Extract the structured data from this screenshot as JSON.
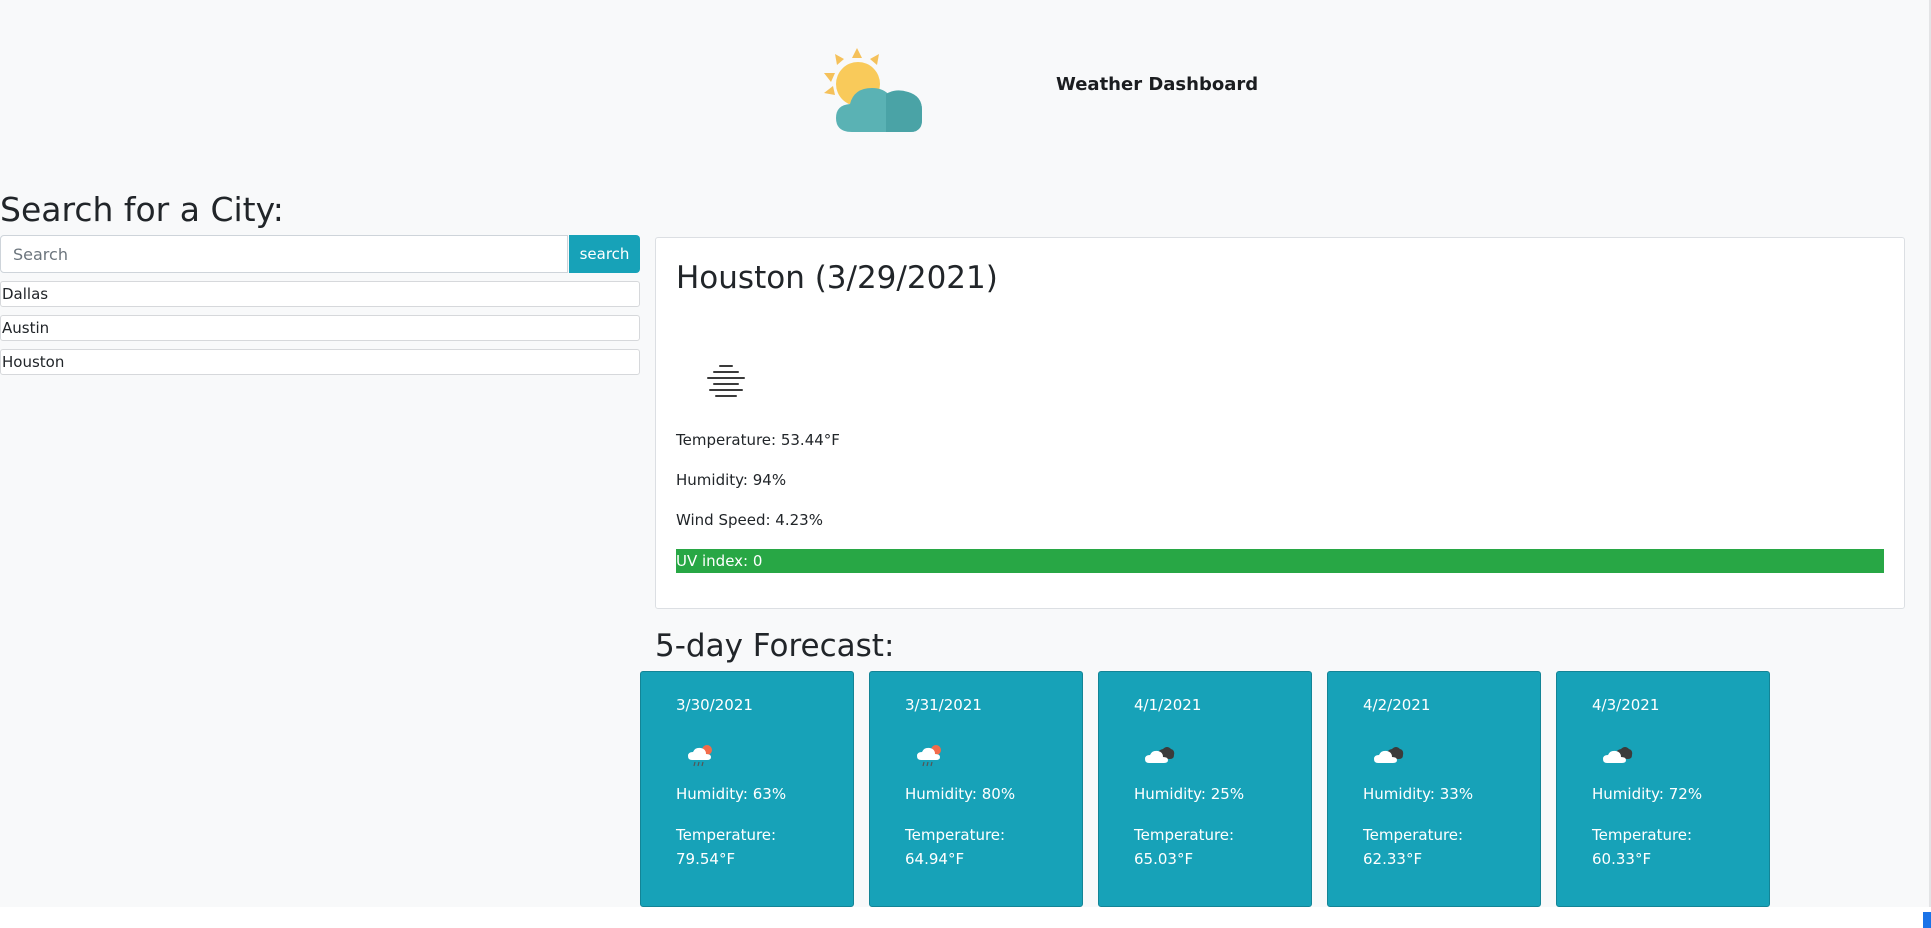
{
  "header": {
    "title": "Weather Dashboard",
    "logo_icon": "sun-behind-cloud-icon"
  },
  "search": {
    "heading": "Search for a City:",
    "placeholder": "Search",
    "value": "",
    "button_label": "search"
  },
  "history": [
    {
      "label": "Dallas"
    },
    {
      "label": "Austin"
    },
    {
      "label": "Houston"
    }
  ],
  "current": {
    "title": "Houston (3/29/2021)",
    "icon": "mist-icon",
    "temperature": "Temperature: 53.44°F",
    "humidity": "Humidity: 94%",
    "wind": "Wind Speed: 4.23%",
    "uv": "UV index: 0",
    "uv_color": "#28a745"
  },
  "forecast": {
    "heading": "5-day Forecast:",
    "card_color": "#17a2b8",
    "days": [
      {
        "date": "3/30/2021",
        "icon": "rain-sun-cloud-icon",
        "humidity": "Humidity: 63%",
        "temp_label": "Temperature:",
        "temp_value": "79.54°F"
      },
      {
        "date": "3/31/2021",
        "icon": "rain-sun-cloud-icon",
        "humidity": "Humidity: 80%",
        "temp_label": "Temperature:",
        "temp_value": "64.94°F"
      },
      {
        "date": "4/1/2021",
        "icon": "broken-clouds-icon",
        "humidity": "Humidity: 25%",
        "temp_label": "Temperature:",
        "temp_value": "65.03°F"
      },
      {
        "date": "4/2/2021",
        "icon": "broken-clouds-icon",
        "humidity": "Humidity: 33%",
        "temp_label": "Temperature:",
        "temp_value": "62.33°F"
      },
      {
        "date": "4/3/2021",
        "icon": "broken-clouds-icon",
        "humidity": "Humidity: 72%",
        "temp_label": "Temperature:",
        "temp_value": "60.33°F"
      }
    ]
  }
}
